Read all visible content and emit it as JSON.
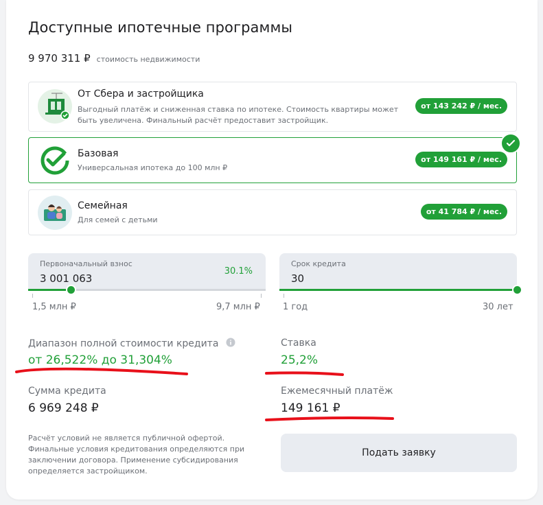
{
  "title": "Доступные ипотечные программы",
  "property": {
    "price": "9 970 311 ₽",
    "caption": "стоимость недвижимости"
  },
  "programs": [
    {
      "name": "От Сбера и застройщика",
      "description": "Выгодный платёж и сниженная ставка по ипотеке. Стоимость квартиры может быть увеличена. Финальный расчёт предоставит застройщик.",
      "payment": "от 143 242 ₽ / мес.",
      "icon": "building-icon",
      "selected": false
    },
    {
      "name": "Базовая",
      "description": "Универсальная ипотека до 100 млн ₽",
      "payment": "от 149 161 ₽ / мес.",
      "icon": "sber-logo-icon",
      "selected": true
    },
    {
      "name": "Семейная",
      "description": "Для семей с детьми",
      "payment": "от 41 784 ₽ / мес.",
      "icon": "family-icon",
      "selected": false
    }
  ],
  "down_payment": {
    "label": "Первоначальный взнос",
    "value": "3 001 063",
    "percent": "30.1%",
    "min": "1,5 млн ₽",
    "max": "9,7 млн ₽",
    "fraction": 0.18
  },
  "term": {
    "label": "Срок кредита",
    "value": "30",
    "min": "1 год",
    "max": "30 лет",
    "fraction": 1.0
  },
  "psk": {
    "label": "Диапазон полной стоимости кредита",
    "value": "от 26,522% до 31,304%"
  },
  "rate": {
    "label": "Ставка",
    "value": "25,2%"
  },
  "loan": {
    "label": "Сумма кредита",
    "value": "6 969 248 ₽"
  },
  "monthly": {
    "label": "Ежемесячный платёж",
    "value": "149 161 ₽"
  },
  "disclaimer": "Расчёт условий не является публичной офертой. Финальные условия кредитования определяются при заключении договора. Применение субсидирования определяется застройщиком.",
  "apply_label": "Подать заявку",
  "colors": {
    "accent": "#21a038",
    "annotation": "#e8101a",
    "panel": "#e9ecf1"
  }
}
